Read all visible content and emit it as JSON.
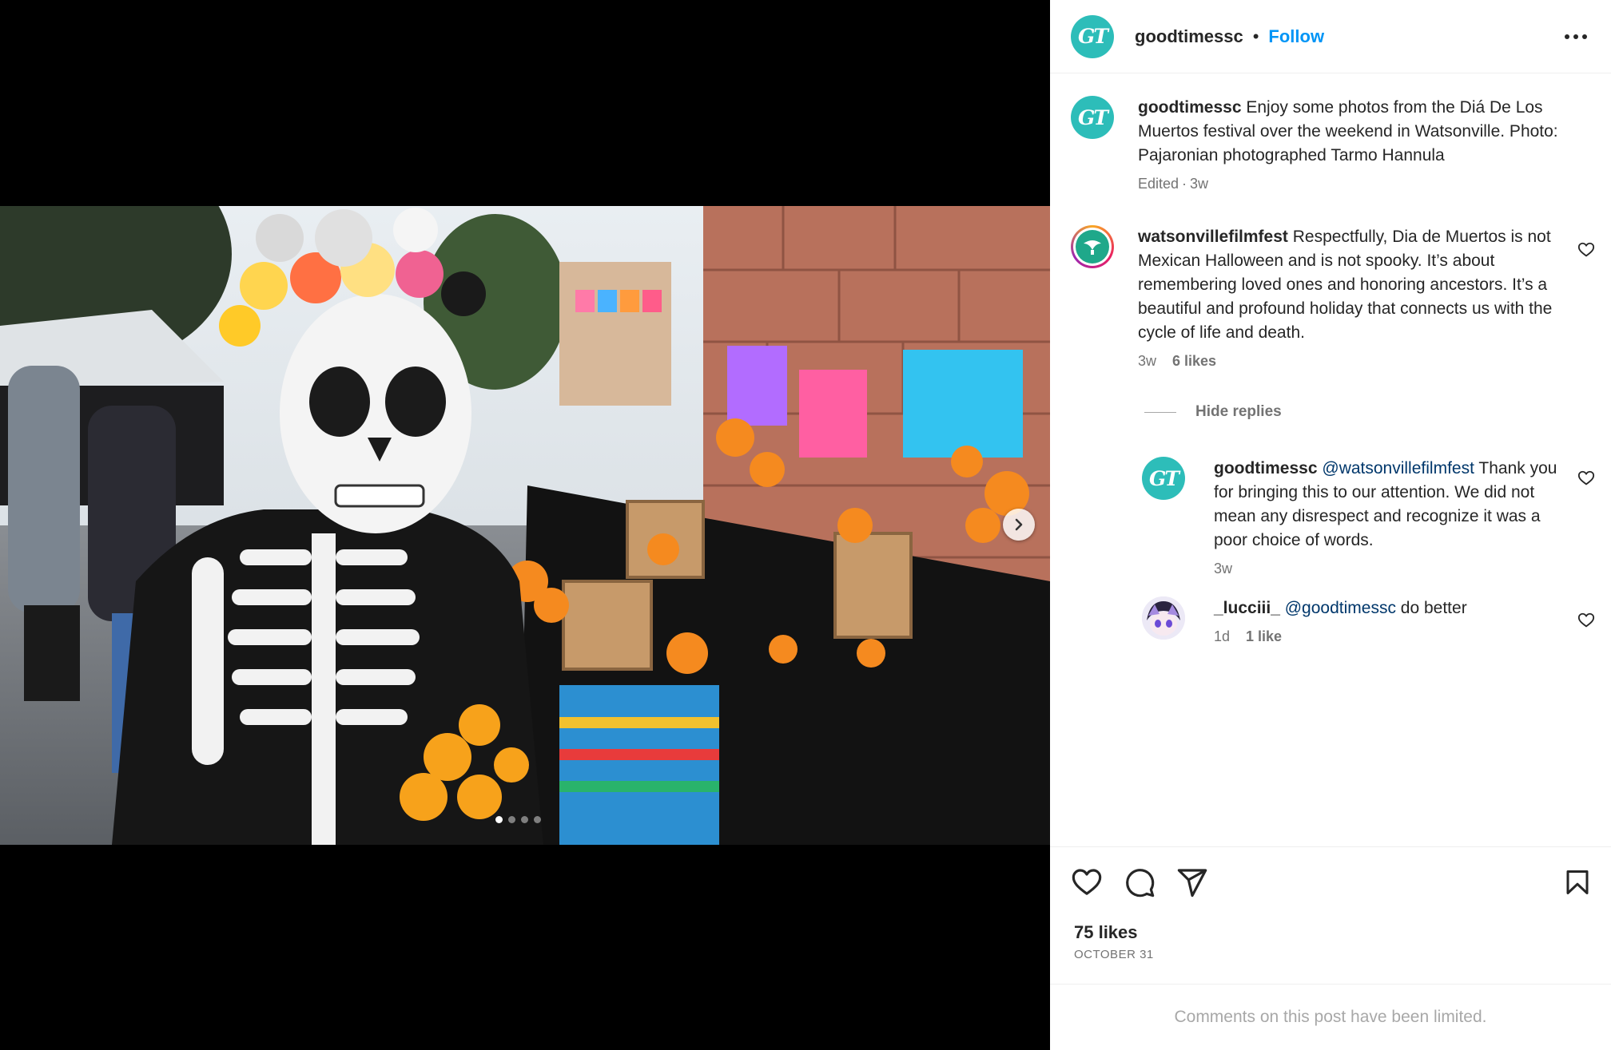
{
  "post": {
    "author": "goodtimessc",
    "avatar_text": "GT",
    "separator": "•",
    "follow_label": "Follow",
    "more_icon": "more-horizontal-icon",
    "carousel": {
      "total": 4,
      "current": 1
    }
  },
  "caption": {
    "username": "goodtimessc",
    "text": "Enjoy some photos from the Diá De Los Muertos festival over the weekend in Watsonville. Photo: Pajaronian photographed Tarmo Hannula",
    "edited": "Edited",
    "dot": "·",
    "time": "3w"
  },
  "comments": [
    {
      "username": "watsonvillefilmfest",
      "text": "Respectfully, Dia de Muertos is not Mexican Halloween and is not spooky. It’s about remembering loved ones and honoring ancestors. It’s a beautiful and profound holiday that connects us with the cycle of life and death.",
      "time": "3w",
      "likes": "6 likes"
    }
  ],
  "hide_replies_label": "Hide replies",
  "replies": [
    {
      "username": "goodtimessc",
      "mention": "@watsonvillefilmfest",
      "text": "Thank you for bringing this to our attention. We did not mean any disrespect and recognize it was a poor choice of words.",
      "time": "3w"
    },
    {
      "username": "_lucciii_",
      "mention": "@goodtimessc",
      "text": "do better",
      "time": "1d",
      "likes": "1 like"
    }
  ],
  "footer": {
    "likes": "75 likes",
    "date": "OCTOBER 31",
    "limited": "Comments on this post have been limited."
  },
  "colors": {
    "accent": "#0095f6",
    "brand_teal": "#2dbdb9",
    "text": "#262626",
    "muted": "#737373"
  }
}
